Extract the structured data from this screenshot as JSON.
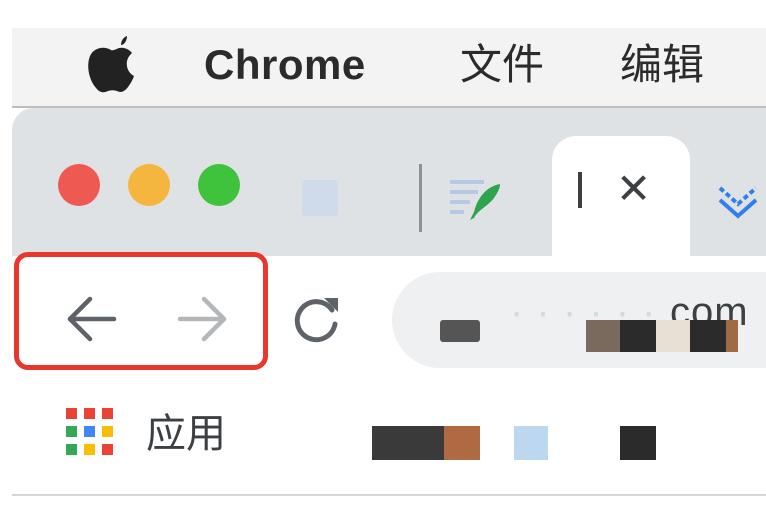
{
  "menubar": {
    "app_name": "Chrome",
    "items": [
      {
        "label": "文件"
      },
      {
        "label": "编辑"
      }
    ]
  },
  "tabs": {
    "active_close_glyph": "✕"
  },
  "toolbar": {
    "url_fragment": "com"
  },
  "bookmarks": {
    "apps_label": "应用"
  },
  "colors": {
    "highlight": "#e8382e",
    "traffic_red": "#ee5a52",
    "traffic_yellow": "#f4b63f",
    "traffic_green": "#3fc23c"
  },
  "icons": [
    "apple-icon",
    "feather-icon",
    "back-arrow-icon",
    "forward-arrow-icon",
    "reload-icon",
    "lock-icon",
    "apps-grid-icon"
  ]
}
